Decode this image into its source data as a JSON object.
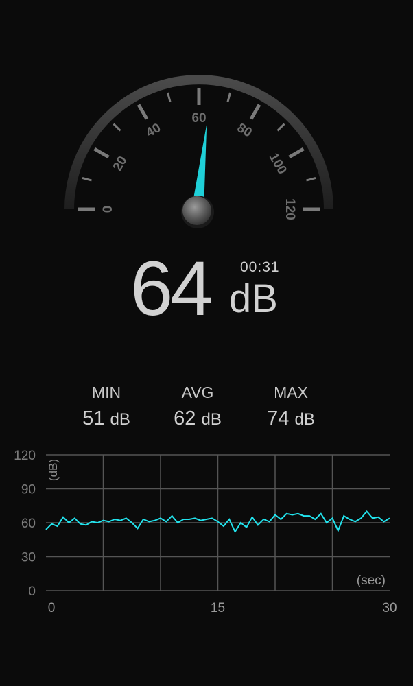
{
  "gauge": {
    "ticks": [
      "0",
      "20",
      "40",
      "60",
      "80",
      "100",
      "120"
    ],
    "needle_value": 64
  },
  "reading": {
    "value": "64",
    "unit": "dB",
    "timer": "00:31"
  },
  "stats": [
    {
      "label": "MIN",
      "value": "51",
      "unit": "dB"
    },
    {
      "label": "AVG",
      "value": "62",
      "unit": "dB"
    },
    {
      "label": "MAX",
      "value": "74",
      "unit": "dB"
    }
  ],
  "chart_data": {
    "type": "line",
    "ylabel": "(dB)",
    "xlabel": "(sec)",
    "y_ticks": [
      "120",
      "90",
      "60",
      "30",
      "0"
    ],
    "x_ticks": [
      "0",
      "15",
      "30"
    ],
    "xlim": [
      0,
      30
    ],
    "ylim": [
      0,
      120
    ],
    "grid": true,
    "series": [
      {
        "x": [
          0,
          0.5,
          1,
          1.5,
          2,
          2.5,
          3,
          3.5,
          4,
          4.5,
          5,
          5.5,
          6,
          6.5,
          7,
          7.5,
          8,
          8.5,
          9,
          9.5,
          10,
          10.5,
          11,
          11.5,
          12,
          12.5,
          13,
          13.5,
          14,
          14.5,
          15,
          15.5,
          16,
          16.5,
          17,
          17.5,
          18,
          18.5,
          19,
          19.5,
          20,
          20.5,
          21,
          21.5,
          22,
          22.5,
          23,
          23.5,
          24,
          24.5,
          25,
          25.5,
          26,
          26.5,
          27,
          27.5,
          28,
          28.5,
          29,
          29.5,
          30
        ],
        "values": [
          54,
          59,
          57,
          65,
          60,
          64,
          59,
          58,
          61,
          60,
          62,
          61,
          63,
          62,
          64,
          60,
          55,
          63,
          61,
          62,
          64,
          61,
          66,
          60,
          63,
          63,
          64,
          62,
          63,
          64,
          61,
          57,
          63,
          52,
          60,
          56,
          65,
          58,
          63,
          61,
          67,
          63,
          68,
          67,
          68,
          66,
          66,
          63,
          68,
          60,
          64,
          53,
          66,
          63,
          61,
          64,
          70,
          64,
          65,
          61,
          64
        ]
      }
    ]
  }
}
